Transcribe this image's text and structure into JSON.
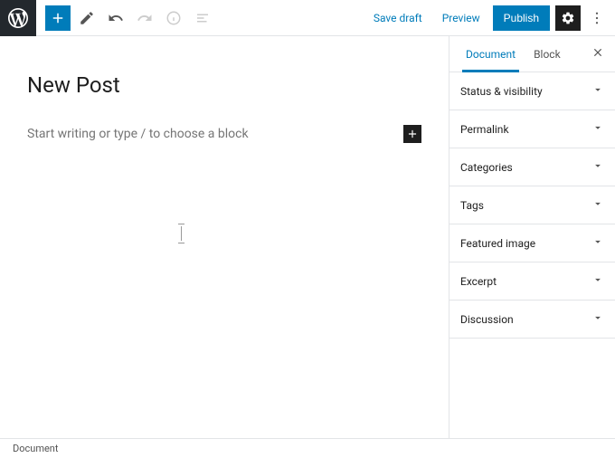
{
  "toolbar": {
    "save_draft": "Save draft",
    "preview": "Preview",
    "publish": "Publish"
  },
  "editor": {
    "title": "New Post",
    "placeholder": "Start writing or type / to choose a block"
  },
  "sidebar": {
    "tabs": {
      "document": "Document",
      "block": "Block"
    },
    "panels": [
      {
        "label": "Status & visibility"
      },
      {
        "label": "Permalink"
      },
      {
        "label": "Categories"
      },
      {
        "label": "Tags"
      },
      {
        "label": "Featured image"
      },
      {
        "label": "Excerpt"
      },
      {
        "label": "Discussion"
      }
    ]
  },
  "footer": {
    "breadcrumb": "Document"
  }
}
